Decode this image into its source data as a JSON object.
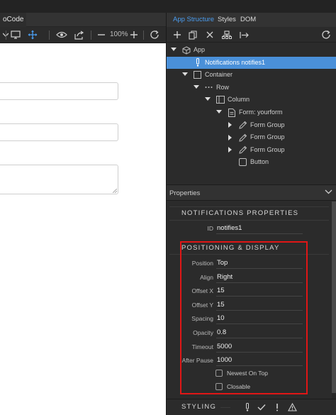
{
  "editor": {
    "tab_label": "oCode",
    "zoom": "100%"
  },
  "panel": {
    "tabs": [
      "App Structure",
      "Styles",
      "DOM"
    ],
    "tree": [
      {
        "label": "App",
        "icon": "cube-icon"
      },
      {
        "label": "Notifications notifies1",
        "icon": "notification-icon",
        "selected": true
      },
      {
        "label": "Container",
        "icon": "container-icon"
      },
      {
        "label": "Row",
        "icon": "row-icon"
      },
      {
        "label": "Column",
        "icon": "column-icon"
      },
      {
        "label": "Form: yourform",
        "icon": "form-icon"
      },
      {
        "label": "Form Group",
        "icon": "pencil-icon"
      },
      {
        "label": "Form Group",
        "icon": "pencil-icon"
      },
      {
        "label": "Form Group",
        "icon": "pencil-icon"
      },
      {
        "label": "Button",
        "icon": "button-icon"
      }
    ],
    "properties_title": "Properties",
    "notifications_section": {
      "title": "NOTIFICATIONS PROPERTIES",
      "id_label": "ID",
      "id_value": "notifies1"
    },
    "positioning_section": {
      "title": "POSITIONING & DISPLAY",
      "rows": [
        {
          "label": "Position",
          "value": "Top"
        },
        {
          "label": "Align",
          "value": "Right"
        },
        {
          "label": "Offset X",
          "value": "15"
        },
        {
          "label": "Offset Y",
          "value": "15"
        },
        {
          "label": "Spacing",
          "value": "10"
        },
        {
          "label": "Opacity",
          "value": "0.8"
        },
        {
          "label": "Timeout",
          "value": "5000"
        },
        {
          "label": "After Pause",
          "value": "1000"
        }
      ],
      "checkboxes": [
        {
          "label": "Newest On Top",
          "checked": false
        },
        {
          "label": "Closable",
          "checked": false
        }
      ]
    },
    "styling_section": {
      "title": "STYLING"
    }
  },
  "colors": {
    "accent": "#4a90d9",
    "tab_active": "#4a9df0",
    "highlight": "#e01616"
  }
}
